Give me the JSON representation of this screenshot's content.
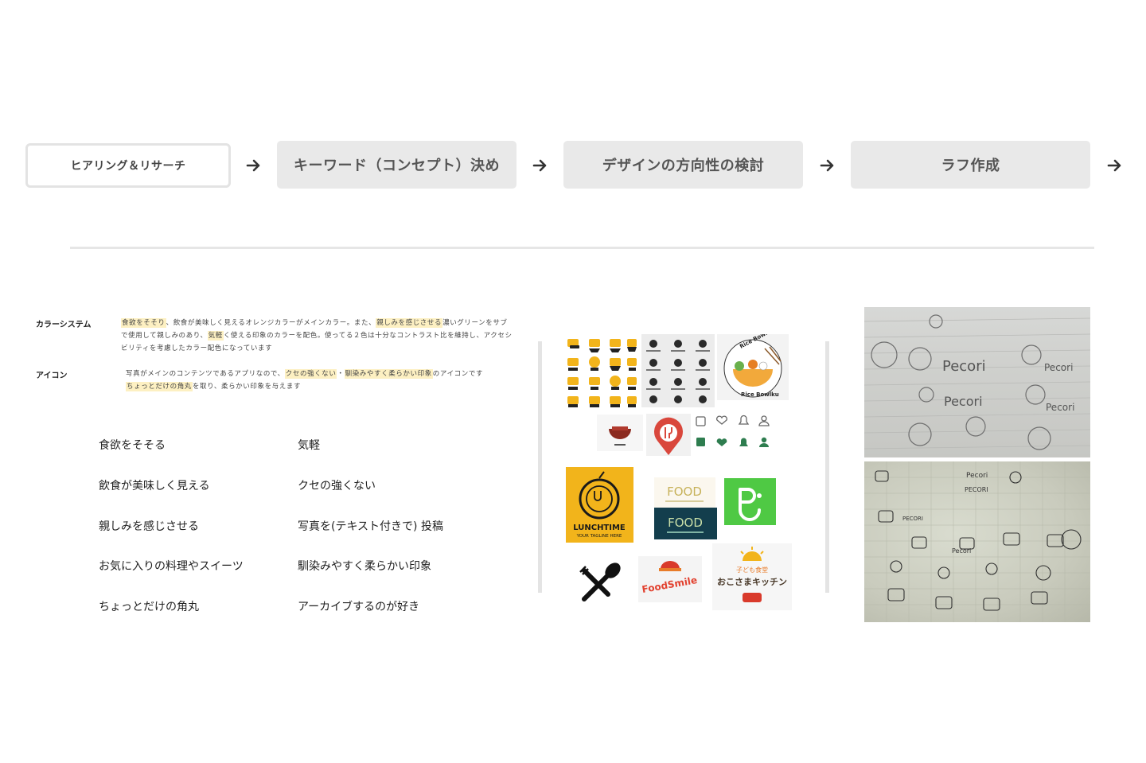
{
  "process": {
    "steps": [
      {
        "label": "ヒアリング＆リサーチ",
        "active": true
      },
      {
        "label": "キーワード（コンセプト）決め",
        "active": false
      },
      {
        "label": "デザインの方向性の検討",
        "active": false
      },
      {
        "label": "ラフ作成",
        "active": false
      }
    ]
  },
  "notes": {
    "color": {
      "label": "カラーシステム",
      "seg1": "食欲をそそり",
      "seg2": "、飲食が美味しく見えるオレンジカラーがメインカラー。また、",
      "seg3": "親しみを感じさせる",
      "seg4": "濃いグリーンをサブで使用して親しみのあり、",
      "seg5": "気軽",
      "seg6": "く使える印象のカラーを配色。使ってる２色は十分なコントラスト比を維持し、アクセシビリティを考慮したカラー配色になっています"
    },
    "icon": {
      "label": "アイコン",
      "seg1": "写真がメインのコンテンツであるアプリなので、",
      "seg2": "クセの強くない",
      "seg3": "・",
      "seg4": "馴染みやすく柔らかい印象",
      "seg5": "のアイコンです",
      "seg6": "ちょっとだけの角丸",
      "seg7": "を取り、柔らかい印象を与えます"
    }
  },
  "keywords": {
    "left": [
      "食欲をそそる",
      "飲食が美味しく見える",
      "親しみを感じさせる",
      "お気に入りの料理やスイーツ",
      "ちょっとだけの角丸"
    ],
    "right": [
      "気軽",
      "クセの強くない",
      "写真を(テキスト付きで) 投稿",
      "馴染みやすく柔らかい印象",
      "アーカイブするのが好き"
    ]
  },
  "moodboard": {
    "rice_logo": {
      "top": "Rice Bowlku",
      "bottom": "Rice Bowlku"
    },
    "lunch_logo": {
      "title": "LUNCHTIME",
      "tagline": "YOUR TAGLINE HERE"
    },
    "food_logo_1": "FOOD",
    "food_logo_2": "FOOD",
    "foodsmile_logo": "FoodSmile",
    "okosama_logo": "おこさまキッチン",
    "okosama_sub": "子ども食堂"
  },
  "sketches": {
    "sheet1": [
      "Pecori",
      "Pecori",
      "Pecori",
      "Pecori"
    ],
    "sheet2": [
      "Pecori",
      "PECORI",
      "PECORI",
      "Pecori"
    ]
  },
  "colors": {
    "orange": "#f2b41b",
    "green": "#2e7d4f",
    "highlight": "#fdf0c2"
  }
}
